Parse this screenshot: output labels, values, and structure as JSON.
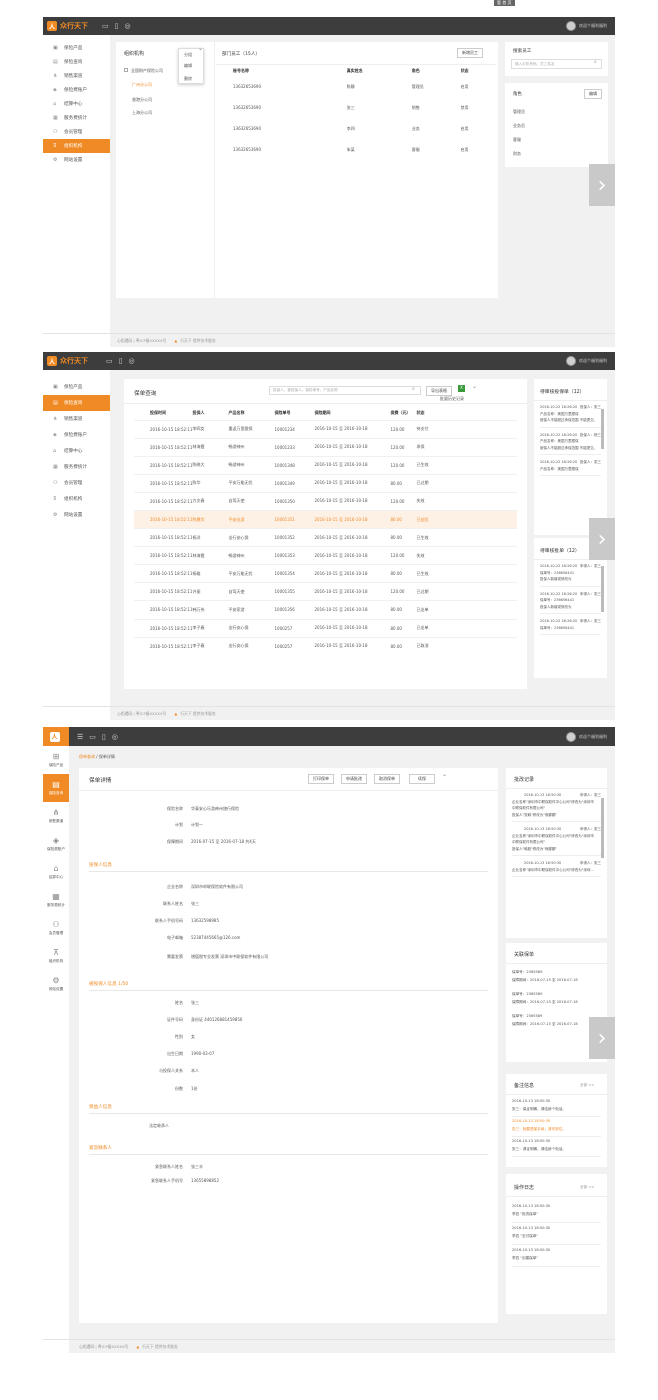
{
  "app": {
    "name": "众行天下",
    "user": "欢迎个福利福利"
  },
  "topbadge": "管 首 页",
  "icons": {
    "monitor": "monitor-icon",
    "phone": "phone-icon",
    "wechat": "wechat-icon"
  },
  "colors": {
    "accent": "#f08a24",
    "topbar": "#3d3d3d"
  },
  "nav": [
    "保险产品",
    "保险查询",
    "销售渠道",
    "保险费账户",
    "结算中心",
    "服务费统计",
    "会员管理",
    "组织机构",
    "网站设置"
  ],
  "footer": {
    "left": "心相遇网 | 粤ICP备XXXXX号",
    "right": "行天下 提供技术服务"
  },
  "s1": {
    "org_title": "组织机构",
    "org_edit": "编辑",
    "org_del": "删除",
    "org_root": "全国财产保险公司",
    "org_items": [
      "广州分公司",
      "香港分公司",
      "上海分公司"
    ],
    "org_drop": "分组",
    "emp_title": "部门员工（15人）",
    "add_emp": "新增员工",
    "emp_cols": [
      "账号名称",
      "真实姓名",
      "角色",
      "状态"
    ],
    "emp_rows": [
      [
        "13632653690",
        "陈静",
        "管理员",
        "启用"
      ],
      [
        "13632653690",
        "张三",
        "销售",
        "禁用"
      ],
      [
        "13632653690",
        "李四",
        "业务",
        "启用"
      ],
      [
        "13632653690",
        "朱某",
        "客服",
        "启用"
      ]
    ],
    "search_title": "搜索员工",
    "search_ph": "输入手机号码、员工姓名",
    "role_title": "角色",
    "role_edit": "编辑",
    "roles": [
      "管理员",
      "业务员",
      "客服",
      "财务"
    ]
  },
  "s2": {
    "title": "保单查询",
    "search_ph": "投保人、被投保人、保险单号、产品名称",
    "btn": "导出表格",
    "menu": "批量历史记录",
    "cols": [
      "投保时间",
      "投保人",
      "产品名称",
      "保险单号",
      "保险期间",
      "保费（元）",
      "状态"
    ],
    "rows": [
      [
        "2016-10-15 18:52:11",
        "李四女",
        "重返万里跟保",
        "10001234",
        "2016-10-15 至 2016-10-18",
        "120.00",
        "待支付"
      ],
      [
        "2016-10-15 18:52:11",
        "林海霞",
        "畅游神州",
        "10001233",
        "2016-10-15 至 2016-10-18",
        "120.00",
        "承保"
      ],
      [
        "2016-10-15 18:52:11",
        "陈晓大",
        "畅游神州",
        "10001348",
        "2016-10-15 至 2016-10-18",
        "120.00",
        "已生效"
      ],
      [
        "2016-10-15 18:52:11",
        "陈华",
        "平安万能无忧",
        "10001349",
        "2016-10-15 至 2016-10-18",
        "80.00",
        "已过期"
      ],
      [
        "2016-10-15 18:52:11",
        "方文春",
        "自驾天使",
        "10001350",
        "2016-10-15 至 2016-10-18",
        "120.00",
        "失效"
      ],
      [
        "2016-10-15 18:52:11",
        "陈慧华",
        "平安出游",
        "10001351",
        "2016-10-15 至 2016-10-18",
        "80.00",
        "已出险"
      ],
      [
        "2016-10-15 18:52:11",
        "杨洋",
        "出行安心保",
        "10001352",
        "2016-10-15 至 2016-10-18",
        "80.00",
        "已生效"
      ],
      [
        "2016-10-15 18:52:11",
        "林海霞",
        "畅游神州",
        "10001353",
        "2016-10-15 至 2016-10-18",
        "120.00",
        "失效"
      ],
      [
        "2016-10-15 18:52:11",
        "杨雄",
        "平安万能无忧",
        "10001354",
        "2016-10-15 至 2016-10-18",
        "80.00",
        "已生效"
      ],
      [
        "2016-10-15 18:52:11",
        "许丽",
        "自驾天使",
        "10001355",
        "2016-10-15 至 2016-10-18",
        "120.00",
        "已过期"
      ],
      [
        "2016-10-15 18:52:11",
        "韩万伟",
        "平安家游",
        "10001356",
        "2016-10-15 至 2016-10-18",
        "80.00",
        "已出单"
      ],
      [
        "2016-10-15 18:52:11",
        "李子春",
        "出行安心保",
        "1000257",
        "2016-10-15 至 2016-10-18",
        "80.00",
        "已出单"
      ],
      [
        "2016-10-15 18:52:11",
        "李子春",
        "出行安心保",
        "1000257",
        "2016-10-15 至 2016-10-18",
        "80.00",
        "已取消"
      ]
    ],
    "pending_title": "待审核投保单（12）",
    "pending": [
      [
        "2016-10-22 18:26:20",
        "投保人：张三",
        "产品名称：美国万里跟保",
        "被保人不能超过承保范围 不能提交。"
      ],
      [
        "2016-10-22 18:26:20",
        "投保人：杨三",
        "产品名称：美国万里跟保",
        "被保人不能超过承保范围 不能提交。"
      ],
      [
        "2016-10-22 18:26:20",
        "投保人：张三",
        "产品名称：美国万里跟保",
        ""
      ]
    ],
    "batch_title": "待审核批单（12）",
    "batch": [
      [
        "2016-10-22 18:26:20",
        "申请人：张三",
        "保单号：236656441",
        "投保人新增或修改为"
      ],
      [
        "2016-10-22 18:26:20",
        "申请人：张三",
        "保单号：236656441",
        "投保人新增或修改为"
      ],
      [
        "2016-10-22 18:26:20",
        "申请人：张三",
        "保单号：236656441",
        ""
      ]
    ]
  },
  "s3": {
    "crumb1": "保单查询",
    "crumb2": "保单详情",
    "title": "保单详情",
    "btns": [
      "打印保单",
      "申请批改",
      "取消保单",
      "续保"
    ],
    "basic": [
      [
        "保险名称",
        "华泰安心乐游神州旅行保险"
      ],
      [
        "计划",
        "计划一"
      ],
      [
        "保障期间",
        "2016-07-15  至  2016-07-18      共4天"
      ]
    ],
    "sec_holder": "投保人信息",
    "holder": [
      [
        "企业名称",
        "深圳市申联保险软件有限公司"
      ],
      [
        "联系人姓名",
        "张三"
      ],
      [
        "联系人手机号码",
        "13632598985"
      ],
      [
        "电子邮箱",
        "52387445665@126.com"
      ],
      [
        "需要发票",
        "增值税专业发票    深圳市中联保软件有限公司"
      ]
    ],
    "sec_insured": "被投保人信息 1/50",
    "insured": [
      [
        "姓名",
        "张三"
      ],
      [
        "证件号码",
        "身份证    440126881459856"
      ],
      [
        "性别",
        "女"
      ],
      [
        "出生日期",
        "1990-03-07"
      ],
      [
        "与投保人关系",
        "本人"
      ],
      [
        "份数",
        "1份"
      ]
    ],
    "sec_benef": "受益人信息",
    "benef": "法定继承人",
    "sec_emerg": "紧急联系人",
    "emerg": [
      [
        "紧急联系人姓名",
        "张三丰"
      ],
      [
        "紧急联系人手机号",
        "13655898852"
      ]
    ],
    "batch_title": "批改记录",
    "batch": [
      {
        "time": "2016-10-13 18:50:30",
        "who": "申请人：张三",
        "l1": "企业名称\"深圳市中联保软件中心公司\"修改为\"深圳市中联保软件有限公司\"",
        "l2": "投保人\"张韩\"修改为\"熊娜娜\""
      },
      {
        "time": "2016-10-13 18:50:30",
        "who": "申请人：张三",
        "l1": "企业名称\"深圳市中联保软件中心公司\"修改为\"深圳市中联保软件有限公司\"",
        "l2": "投保人\"韩毅\"修改为\"熊娜娜\""
      },
      {
        "time": "2016-10-13 18:50:30",
        "who": "申请人：张三",
        "l1": "企业名称\"深圳市中联保软件中心公司\"修改为\"深圳...",
        "l2": ""
      }
    ],
    "rel_title": "关联保单",
    "rel": [
      [
        "保单号：2365589",
        "保障期间：2016-07-15  至  2016-07-18"
      ],
      [
        "保单号：2365589",
        "保障期间：2016-07-15  至  2016-07-18"
      ],
      [
        "保单号：2365589",
        "保障期间：2016-07-15  至  2016-07-18"
      ]
    ],
    "note_title": "备注信息",
    "more": "全部 >>",
    "notes": [
      [
        "2016-10-13 18:50:30",
        "张三：保证明确，请给我个电话。",
        false
      ],
      [
        "2016-10-13 18:50:30",
        "张三：我要退保手续，请尽到位。",
        true
      ],
      [
        "2016-10-13 18:50:30",
        "张三：请证明确，请给我个电话。",
        false
      ]
    ],
    "log_title": "操作日志",
    "logs": [
      [
        "2016-10-13 18:50:30",
        "李四 \"批改保单\""
      ],
      [
        "2016-10-13 18:50:30",
        "李四 \"支付保单\""
      ],
      [
        "2016-10-13 18:50:30",
        "李四 \"创建保单\""
      ]
    ]
  }
}
